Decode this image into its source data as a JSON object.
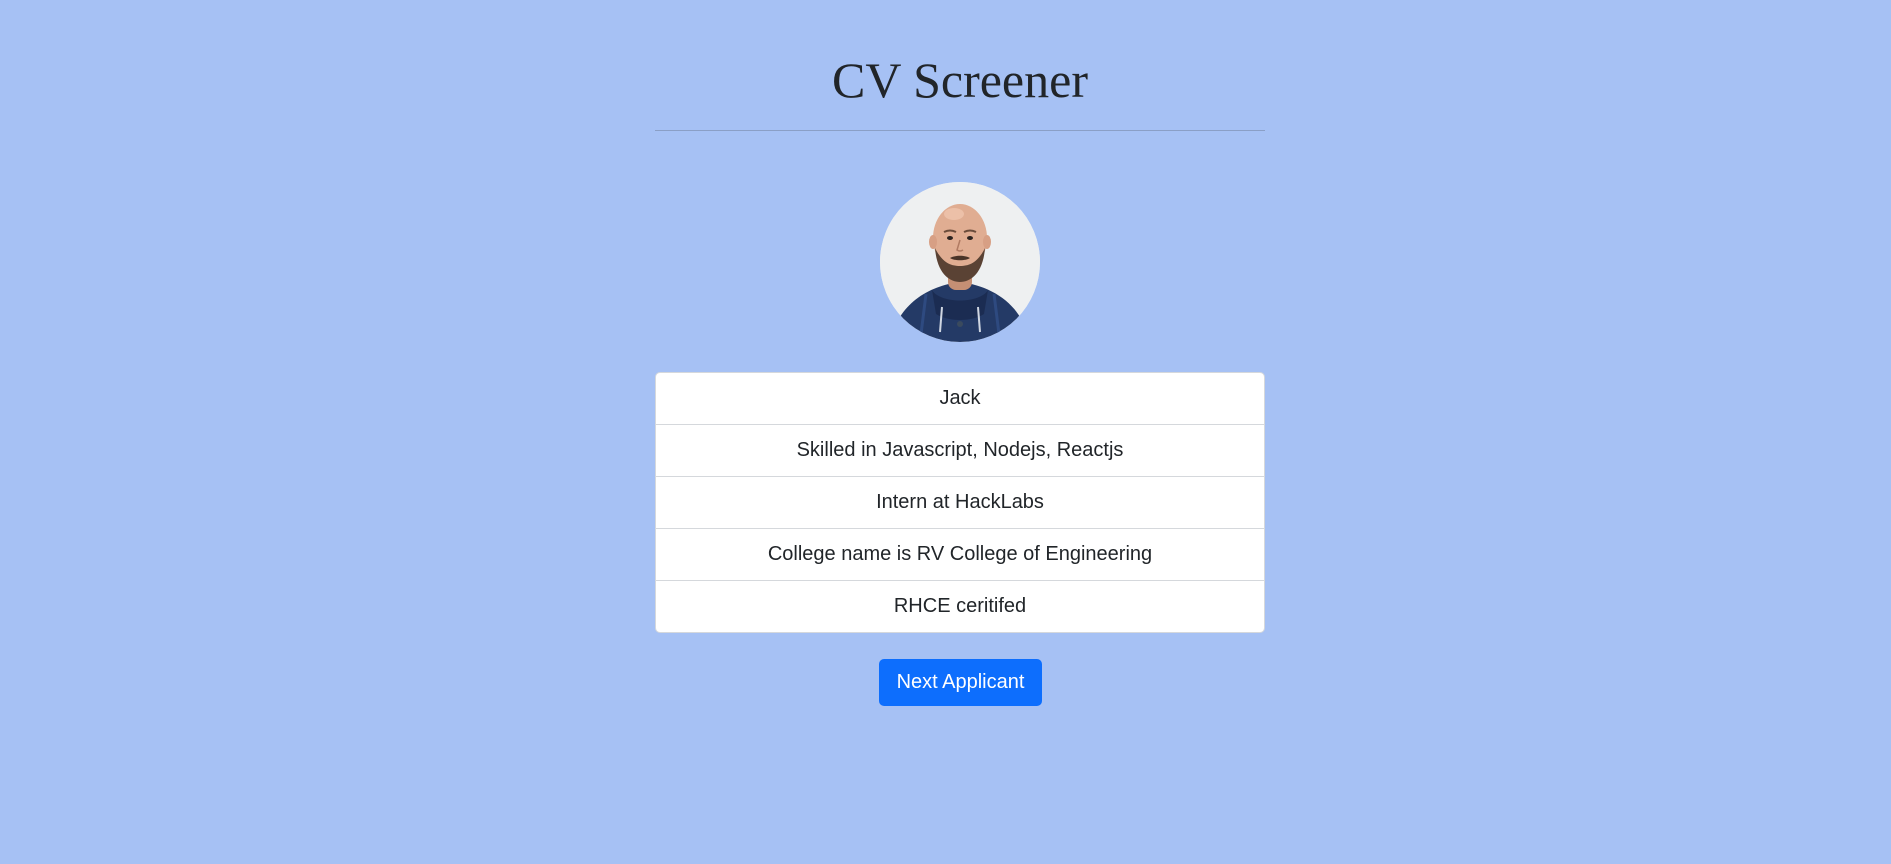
{
  "page": {
    "title": "CV Screener",
    "background_color": "#a6c1f4"
  },
  "applicant": {
    "avatar": {
      "icon": "applicant-photo",
      "alt": "Applicant photo"
    },
    "details": [
      "Jack",
      "Skilled in Javascript, Nodejs, Reactjs",
      "Intern at HackLabs",
      "College name is RV College of Engineering",
      "RHCE ceritifed"
    ]
  },
  "actions": {
    "next_label": "Next Applicant",
    "accent_color": "#0d6efd"
  }
}
